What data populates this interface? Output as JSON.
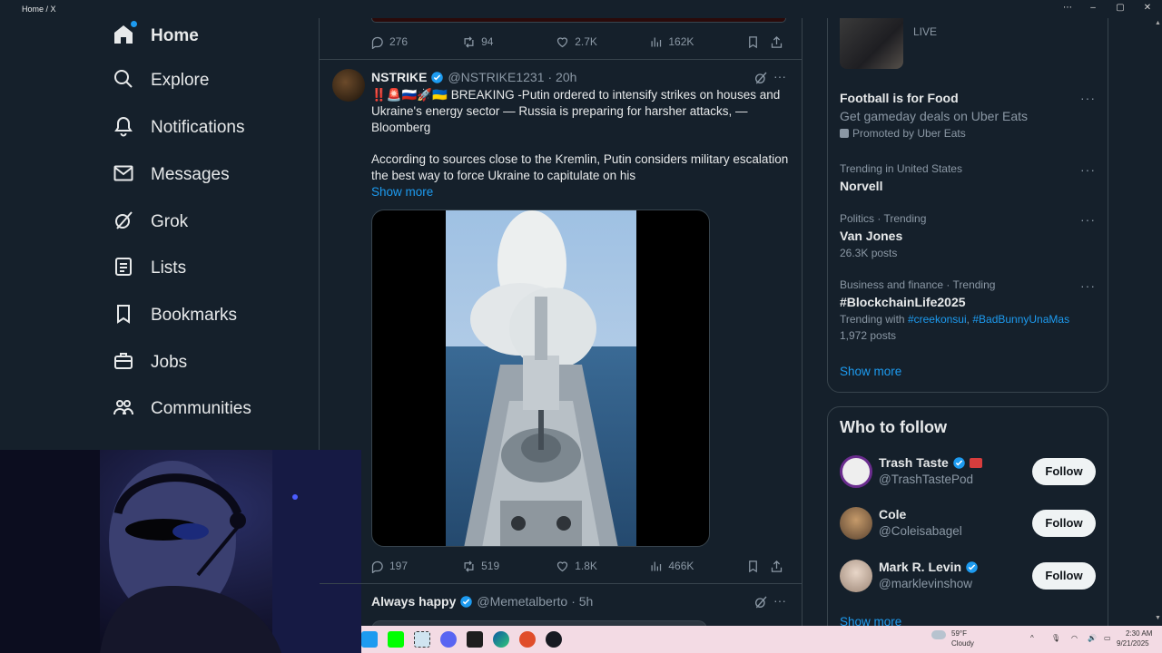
{
  "window": {
    "title": "Home / X"
  },
  "nav": {
    "items": [
      {
        "label": "Home",
        "icon": "home-icon"
      },
      {
        "label": "Explore",
        "icon": "search-icon"
      },
      {
        "label": "Notifications",
        "icon": "bell-icon"
      },
      {
        "label": "Messages",
        "icon": "mail-icon"
      },
      {
        "label": "Grok",
        "icon": "grok-icon"
      },
      {
        "label": "Lists",
        "icon": "list-icon"
      },
      {
        "label": "Bookmarks",
        "icon": "bookmark-icon"
      },
      {
        "label": "Jobs",
        "icon": "briefcase-icon"
      },
      {
        "label": "Communities",
        "icon": "people-icon"
      }
    ]
  },
  "feed": {
    "prev_tweet": {
      "replies": "276",
      "retweets": "94",
      "likes": "2.7K",
      "views": "162K"
    },
    "tweet": {
      "name": "NSTRIKE",
      "handle": "@NSTRIKE1231",
      "time": "· 20h",
      "text": "‼️🚨🇷🇺🚀🇺🇦 BREAKING -Putin ordered to intensify strikes on houses and Ukraine's energy sector — Russia is preparing for harsher attacks, — Bloomberg",
      "text2": "According to sources close to the Kremlin, Putin considers military escalation the best way to force Ukraine to capitulate on his",
      "show_more": "Show more",
      "replies": "197",
      "retweets": "519",
      "likes": "1.8K",
      "views": "466K"
    },
    "next_tweet": {
      "name": "Always happy",
      "handle": "@Memetalberto",
      "time": "· 5h"
    }
  },
  "right": {
    "live": {
      "status": "LIVE"
    },
    "ad": {
      "title": "Football is for Food",
      "desc": "Get gameday deals on Uber Eats",
      "promoted": "Promoted by Uber Eats"
    },
    "trends": [
      {
        "meta": "Trending in United States",
        "topic": "Norvell"
      },
      {
        "meta": "Politics · Trending",
        "topic": "Van Jones",
        "sub": "26.3K posts"
      },
      {
        "meta": "Business and finance · Trending",
        "topic": "#BlockchainLife2025",
        "with_label": "Trending with",
        "with_1": "#creekonsui",
        "with_sep": ",",
        "with_2": "#BadBunnyUnaMas",
        "sub": "1,972 posts"
      }
    ],
    "show_more": "Show more",
    "who_to_follow": {
      "title": "Who to follow",
      "users": [
        {
          "name": "Trash Taste",
          "handle": "@TrashTastePod",
          "button": "Follow"
        },
        {
          "name": "Cole",
          "handle": "@Coleisabagel",
          "button": "Follow"
        },
        {
          "name": "Mark R. Levin",
          "handle": "@marklevinshow",
          "button": "Follow"
        }
      ],
      "show_more": "Show more"
    }
  },
  "taskbar": {
    "weather_temp": "59°F",
    "weather_desc": "Cloudy",
    "time": "2:30 AM",
    "date": "9/21/2025"
  },
  "colors": {
    "accent": "#1d9bf0",
    "background": "#15202b",
    "border": "#38444d"
  }
}
